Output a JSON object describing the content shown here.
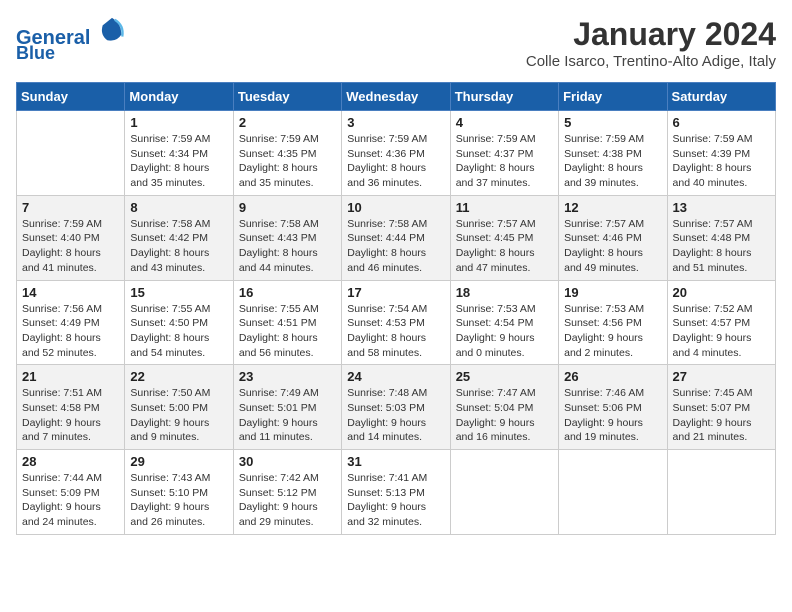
{
  "header": {
    "logo_line1": "General",
    "logo_line2": "Blue",
    "month_title": "January 2024",
    "location": "Colle Isarco, Trentino-Alto Adige, Italy"
  },
  "days_of_week": [
    "Sunday",
    "Monday",
    "Tuesday",
    "Wednesday",
    "Thursday",
    "Friday",
    "Saturday"
  ],
  "weeks": [
    [
      {
        "day": "",
        "info": ""
      },
      {
        "day": "1",
        "info": "Sunrise: 7:59 AM\nSunset: 4:34 PM\nDaylight: 8 hours\nand 35 minutes."
      },
      {
        "day": "2",
        "info": "Sunrise: 7:59 AM\nSunset: 4:35 PM\nDaylight: 8 hours\nand 35 minutes."
      },
      {
        "day": "3",
        "info": "Sunrise: 7:59 AM\nSunset: 4:36 PM\nDaylight: 8 hours\nand 36 minutes."
      },
      {
        "day": "4",
        "info": "Sunrise: 7:59 AM\nSunset: 4:37 PM\nDaylight: 8 hours\nand 37 minutes."
      },
      {
        "day": "5",
        "info": "Sunrise: 7:59 AM\nSunset: 4:38 PM\nDaylight: 8 hours\nand 39 minutes."
      },
      {
        "day": "6",
        "info": "Sunrise: 7:59 AM\nSunset: 4:39 PM\nDaylight: 8 hours\nand 40 minutes."
      }
    ],
    [
      {
        "day": "7",
        "info": "Sunrise: 7:59 AM\nSunset: 4:40 PM\nDaylight: 8 hours\nand 41 minutes."
      },
      {
        "day": "8",
        "info": "Sunrise: 7:58 AM\nSunset: 4:42 PM\nDaylight: 8 hours\nand 43 minutes."
      },
      {
        "day": "9",
        "info": "Sunrise: 7:58 AM\nSunset: 4:43 PM\nDaylight: 8 hours\nand 44 minutes."
      },
      {
        "day": "10",
        "info": "Sunrise: 7:58 AM\nSunset: 4:44 PM\nDaylight: 8 hours\nand 46 minutes."
      },
      {
        "day": "11",
        "info": "Sunrise: 7:57 AM\nSunset: 4:45 PM\nDaylight: 8 hours\nand 47 minutes."
      },
      {
        "day": "12",
        "info": "Sunrise: 7:57 AM\nSunset: 4:46 PM\nDaylight: 8 hours\nand 49 minutes."
      },
      {
        "day": "13",
        "info": "Sunrise: 7:57 AM\nSunset: 4:48 PM\nDaylight: 8 hours\nand 51 minutes."
      }
    ],
    [
      {
        "day": "14",
        "info": "Sunrise: 7:56 AM\nSunset: 4:49 PM\nDaylight: 8 hours\nand 52 minutes."
      },
      {
        "day": "15",
        "info": "Sunrise: 7:55 AM\nSunset: 4:50 PM\nDaylight: 8 hours\nand 54 minutes."
      },
      {
        "day": "16",
        "info": "Sunrise: 7:55 AM\nSunset: 4:51 PM\nDaylight: 8 hours\nand 56 minutes."
      },
      {
        "day": "17",
        "info": "Sunrise: 7:54 AM\nSunset: 4:53 PM\nDaylight: 8 hours\nand 58 minutes."
      },
      {
        "day": "18",
        "info": "Sunrise: 7:53 AM\nSunset: 4:54 PM\nDaylight: 9 hours\nand 0 minutes."
      },
      {
        "day": "19",
        "info": "Sunrise: 7:53 AM\nSunset: 4:56 PM\nDaylight: 9 hours\nand 2 minutes."
      },
      {
        "day": "20",
        "info": "Sunrise: 7:52 AM\nSunset: 4:57 PM\nDaylight: 9 hours\nand 4 minutes."
      }
    ],
    [
      {
        "day": "21",
        "info": "Sunrise: 7:51 AM\nSunset: 4:58 PM\nDaylight: 9 hours\nand 7 minutes."
      },
      {
        "day": "22",
        "info": "Sunrise: 7:50 AM\nSunset: 5:00 PM\nDaylight: 9 hours\nand 9 minutes."
      },
      {
        "day": "23",
        "info": "Sunrise: 7:49 AM\nSunset: 5:01 PM\nDaylight: 9 hours\nand 11 minutes."
      },
      {
        "day": "24",
        "info": "Sunrise: 7:48 AM\nSunset: 5:03 PM\nDaylight: 9 hours\nand 14 minutes."
      },
      {
        "day": "25",
        "info": "Sunrise: 7:47 AM\nSunset: 5:04 PM\nDaylight: 9 hours\nand 16 minutes."
      },
      {
        "day": "26",
        "info": "Sunrise: 7:46 AM\nSunset: 5:06 PM\nDaylight: 9 hours\nand 19 minutes."
      },
      {
        "day": "27",
        "info": "Sunrise: 7:45 AM\nSunset: 5:07 PM\nDaylight: 9 hours\nand 21 minutes."
      }
    ],
    [
      {
        "day": "28",
        "info": "Sunrise: 7:44 AM\nSunset: 5:09 PM\nDaylight: 9 hours\nand 24 minutes."
      },
      {
        "day": "29",
        "info": "Sunrise: 7:43 AM\nSunset: 5:10 PM\nDaylight: 9 hours\nand 26 minutes."
      },
      {
        "day": "30",
        "info": "Sunrise: 7:42 AM\nSunset: 5:12 PM\nDaylight: 9 hours\nand 29 minutes."
      },
      {
        "day": "31",
        "info": "Sunrise: 7:41 AM\nSunset: 5:13 PM\nDaylight: 9 hours\nand 32 minutes."
      },
      {
        "day": "",
        "info": ""
      },
      {
        "day": "",
        "info": ""
      },
      {
        "day": "",
        "info": ""
      }
    ]
  ]
}
